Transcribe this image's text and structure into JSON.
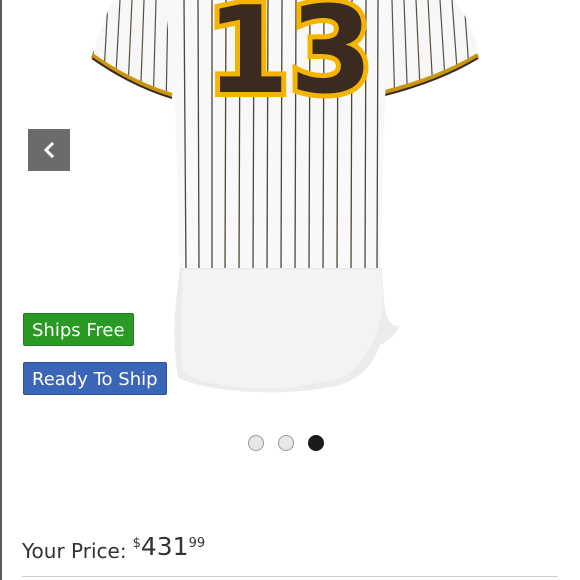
{
  "product": {
    "jersey_number": "13",
    "image_alt": "Pinstripe baseball jersey back view"
  },
  "carousel": {
    "prev_icon": "chevron-left-icon",
    "dots": [
      {
        "active": false
      },
      {
        "active": false
      },
      {
        "active": true
      }
    ]
  },
  "badges": {
    "ships_free": "Ships Free",
    "ready_to_ship": "Ready To Ship"
  },
  "price": {
    "label": "Your Price:",
    "currency": "$",
    "dollars": "431",
    "cents": "99"
  },
  "colors": {
    "badge_green": "#2a9a25",
    "badge_blue": "#3b65b7",
    "jersey_brown": "#3b2a1f",
    "jersey_gold": "#f5b400"
  }
}
